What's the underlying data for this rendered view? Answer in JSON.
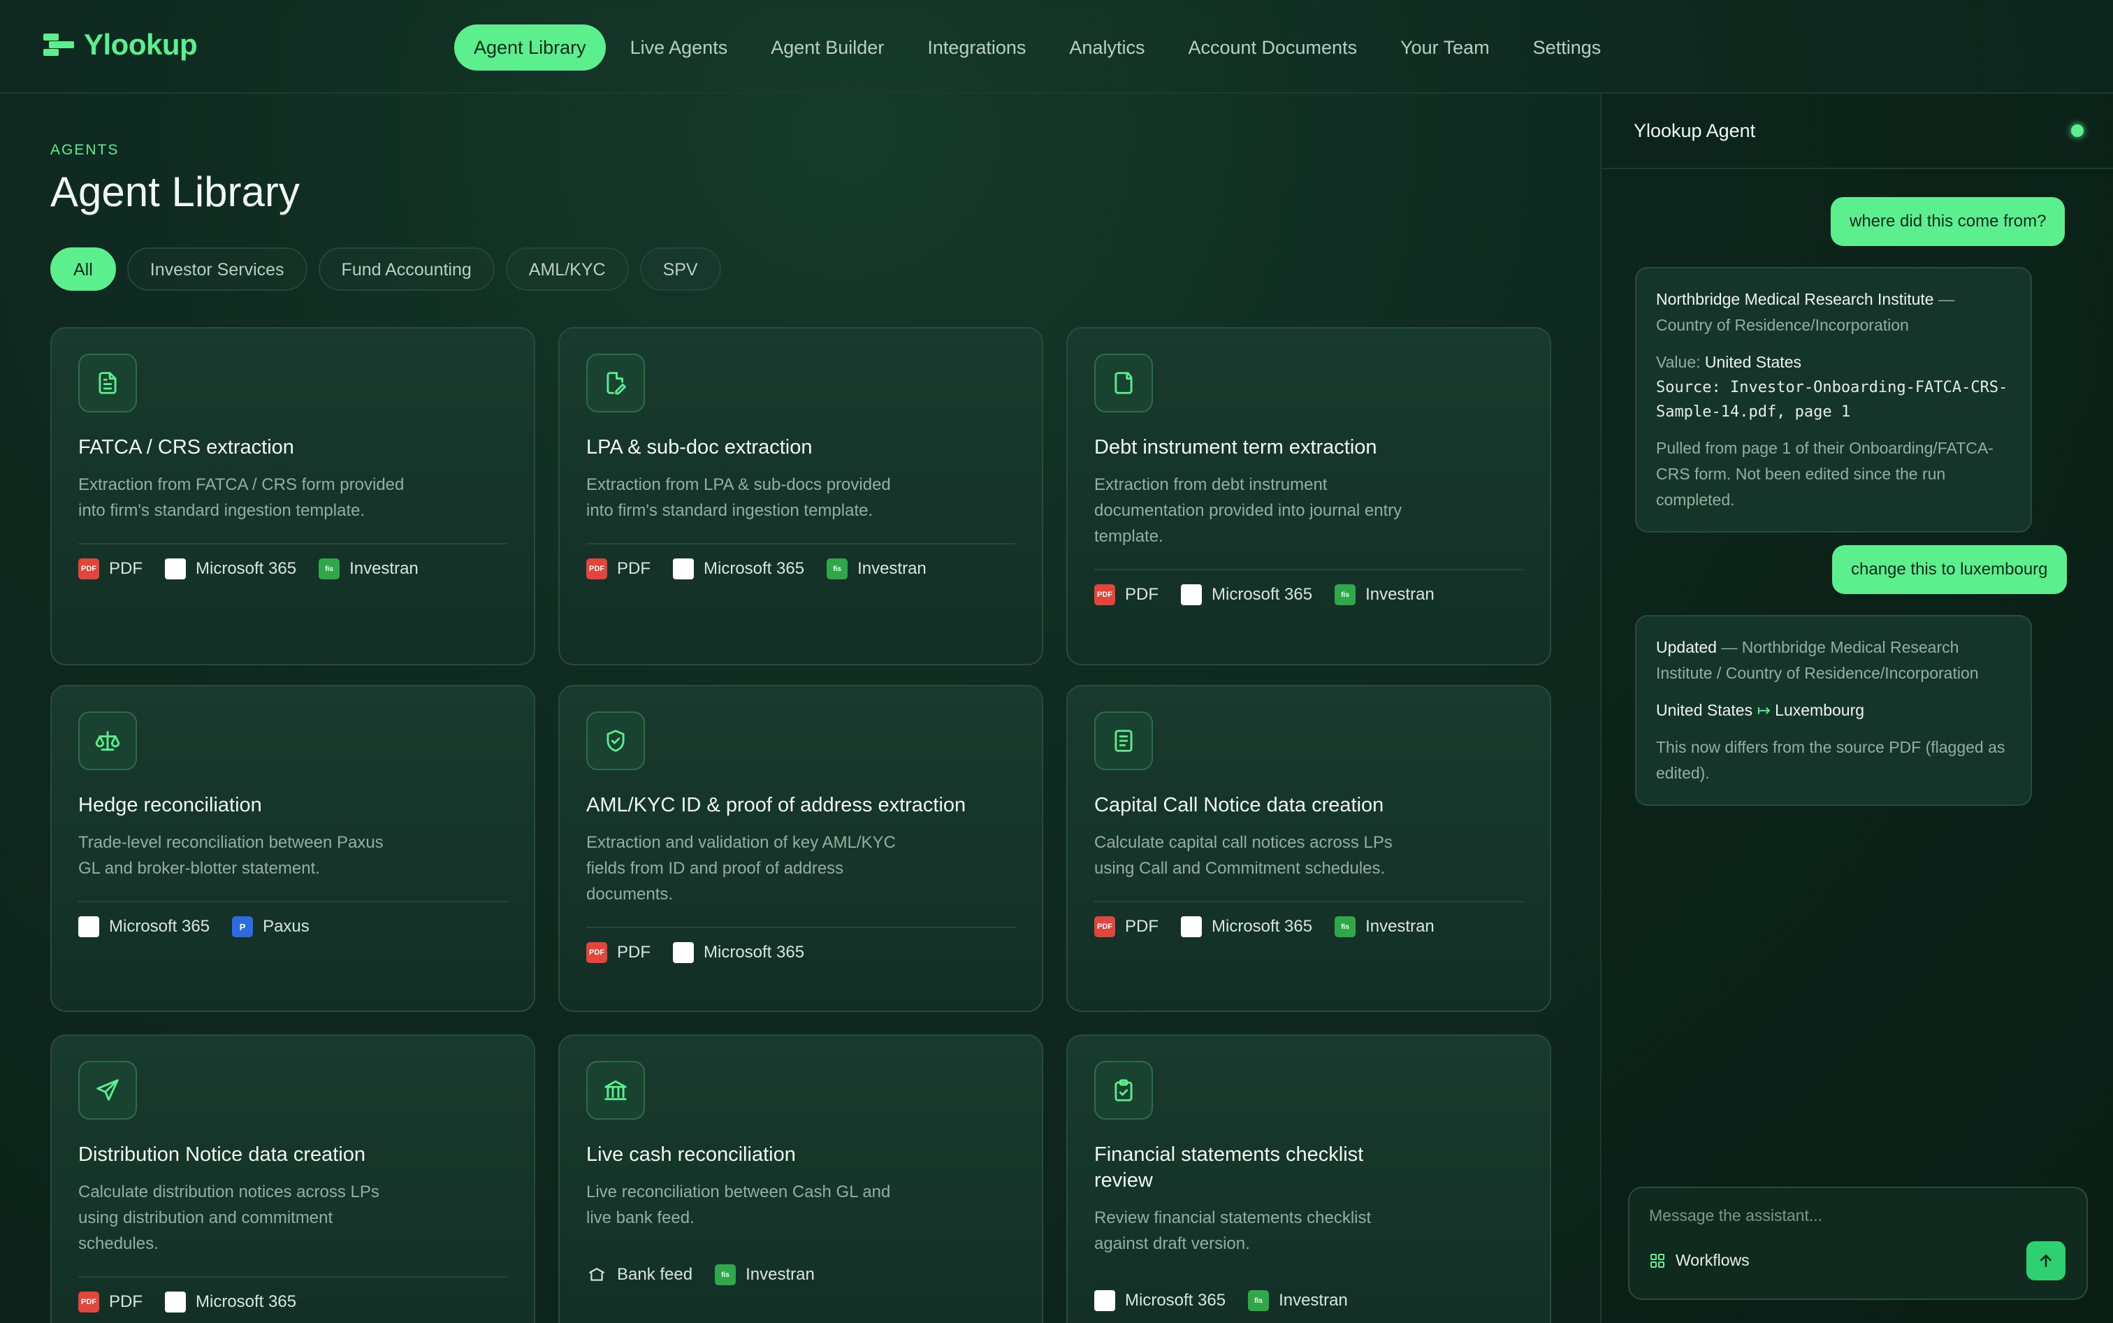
{
  "app": {
    "name": "Ylookup",
    "accent": "#5cef8e"
  },
  "nav": {
    "items": [
      {
        "label": "Agent Library",
        "active": true
      },
      {
        "label": "Live Agents"
      },
      {
        "label": "Agent Builder"
      },
      {
        "label": "Integrations"
      },
      {
        "label": "Analytics"
      },
      {
        "label": "Account Documents"
      },
      {
        "label": "Your Team"
      },
      {
        "label": "Settings"
      }
    ]
  },
  "header": {
    "section": "AGENTS",
    "title": "Agent Library"
  },
  "filters": [
    "All",
    "Investor Services",
    "Fund Accounting",
    "AML/KYC",
    "SPV"
  ],
  "cards": [
    {
      "icon": "document-icon",
      "title": "FATCA / CRS extraction",
      "desc": "Extraction from FATCA / CRS form provided into firm's standard ingestion template.",
      "tags": [
        {
          "type": "pdf",
          "label": "PDF"
        },
        {
          "type": "ms",
          "label": "Microsoft 365"
        },
        {
          "type": "fis",
          "label": "Investran"
        }
      ]
    },
    {
      "icon": "file-edit-icon",
      "title": "LPA & sub-doc extraction",
      "desc": "Extraction from LPA & sub-docs provided into firm's standard ingestion template.",
      "tags": [
        {
          "type": "pdf",
          "label": "PDF"
        },
        {
          "type": "ms",
          "label": "Microsoft 365"
        },
        {
          "type": "fis",
          "label": "Investran"
        }
      ]
    },
    {
      "icon": "sticky-note-icon",
      "title": "Debt instrument term extraction",
      "desc": "Extraction from debt instrument documentation provided into journal entry template.",
      "tags": [
        {
          "type": "pdf",
          "label": "PDF"
        },
        {
          "type": "ms",
          "label": "Microsoft 365"
        },
        {
          "type": "fis",
          "label": "Investran"
        }
      ]
    },
    {
      "icon": "scale-icon",
      "title": "Hedge reconciliation",
      "desc": "Trade-level reconciliation between Paxus GL and broker-blotter statement.",
      "tags": [
        {
          "type": "ms",
          "label": "Microsoft 365"
        },
        {
          "type": "paxus",
          "label": "Paxus"
        }
      ]
    },
    {
      "icon": "shield-check-icon",
      "title": "AML/KYC ID & proof of address extraction",
      "desc": "Extraction and validation of key AML/KYC fields from ID and proof of address documents.",
      "tags": [
        {
          "type": "pdf",
          "label": "PDF"
        },
        {
          "type": "ms",
          "label": "Microsoft 365"
        }
      ]
    },
    {
      "icon": "receipt-icon",
      "title": "Capital Call Notice data creation",
      "desc": "Calculate capital call notices across LPs using Call and Commitment schedules.",
      "tags": [
        {
          "type": "pdf",
          "label": "PDF"
        },
        {
          "type": "ms",
          "label": "Microsoft 365"
        },
        {
          "type": "fis",
          "label": "Investran"
        }
      ]
    },
    {
      "icon": "send-icon",
      "title": "Distribution Notice data creation",
      "desc": "Calculate distribution notices across LPs using distribution and commitment schedules.",
      "tags": [
        {
          "type": "pdf",
          "label": "PDF"
        },
        {
          "type": "ms",
          "label": "Microsoft 365"
        }
      ]
    },
    {
      "icon": "bank-icon",
      "title": "Live cash reconciliation",
      "desc": "Live reconciliation between Cash GL and live bank feed.",
      "tags": [
        {
          "type": "bank",
          "label": "Bank feed"
        },
        {
          "type": "fis",
          "label": "Investran"
        }
      ]
    },
    {
      "icon": "clipboard-check-icon",
      "title": "Financial statements checklist review",
      "desc": "Review financial statements checklist against draft version.",
      "tags": [
        {
          "type": "ms",
          "label": "Microsoft 365"
        },
        {
          "type": "fis",
          "label": "Investran"
        }
      ]
    }
  ],
  "panel": {
    "title": "Ylookup Agent",
    "messages": {
      "user1": "where did this come from?",
      "bot1": {
        "entity": "Northbridge Medical Research Institute",
        "field": "Country of Residence/Incorporation",
        "value_label": "Value:",
        "value": "United States",
        "source_label": "Source:",
        "source": "Investor-Onboarding-FATCA-CRS-Sample-14.pdf, page 1",
        "note": "Pulled from page 1 of their Onboarding/FATCA-CRS form. Not been edited since the run completed."
      },
      "user2": "change this to luxembourg",
      "bot2": {
        "status": "Updated",
        "detail": "Northbridge Medical Research Institute / Country of Residence/Incorporation",
        "from": "United States",
        "to": "Luxembourg",
        "note": "This now differs from the source PDF (flagged as edited)."
      }
    },
    "composer": {
      "placeholder": "Message the assistant...",
      "workflows": "Workflows"
    }
  }
}
